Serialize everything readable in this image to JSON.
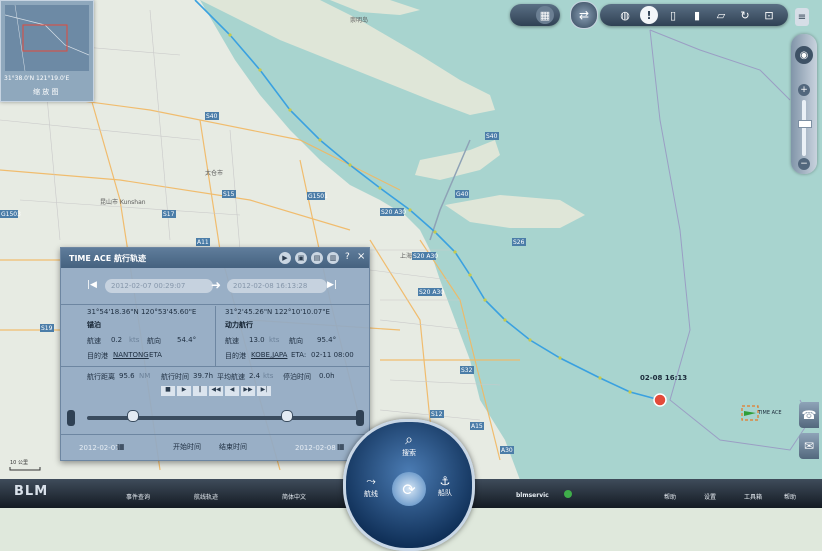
{
  "map": {
    "labels": [
      "S40",
      "S40",
      "G40",
      "G1501",
      "S20",
      "S20 A30",
      "S20 A30",
      "S20 A30",
      "S15",
      "S17",
      "S32",
      "S12",
      "S19",
      "A11",
      "S26",
      "A30",
      "A15",
      "S4",
      "G1503",
      "A20",
      "S5",
      "昆山市 Kunshan",
      "太仓市",
      "舟山群岛",
      "上海"
    ],
    "route_label": "02-08 16:13",
    "vessel_label": "TIME ACE"
  },
  "minimap": {
    "coord_text": "31°38.0'N 121°19.0'E",
    "label": "缩 放 图"
  },
  "toolbar": {
    "icons": [
      "globe-icon",
      "info-icon",
      "list-icon",
      "ruler-icon",
      "note-icon",
      "refresh-icon",
      "settings-icon"
    ]
  },
  "panel": {
    "title": "TIME ACE 航行轨迹",
    "start_time": "2012-02-07 00:29:07",
    "end_time": "2012-02-08 16:13:28",
    "left": {
      "coord": "31°54'18.36\"N 120°53'45.60\"E",
      "status": "锚泊",
      "speed_label": "航速",
      "speed": "0.2",
      "speed_unit": "kts",
      "course_label": "航向",
      "course": "54.4°",
      "dest_label": "目的港",
      "dest": "NANTONG",
      "eta_label": "ETA"
    },
    "right": {
      "coord": "31°2'45.26\"N 122°10'10.07\"E",
      "status": "动力航行",
      "speed_label": "航速",
      "speed": "13.0",
      "speed_unit": "kts",
      "course_label": "航向",
      "course": "95.4°",
      "dest_label": "目的港",
      "dest": "KOBE,JAPA",
      "eta_label": "ETA:",
      "eta": "02-11 08:00"
    },
    "stats": {
      "range_label": "航行距离",
      "range": "95.6",
      "range_unit": "NM",
      "time_label": "航行时间",
      "time": "39.7h",
      "avg_label": "平均航速",
      "avg": "2.4",
      "avg_unit": "kts",
      "stop_label": "停泊时间",
      "stop": "0.0h"
    },
    "footer": {
      "start_date": "2012-02-07",
      "start_btn": "开始时间",
      "end_btn": "结束时间",
      "end_date": "2012-02-08"
    }
  },
  "hub": {
    "top": "搜索",
    "left": "航线",
    "right": "船队"
  },
  "bottom": {
    "logo": "BLM",
    "items": [
      "事件查询",
      "航线轨迹",
      "简体中文"
    ],
    "user": "blmservic",
    "right_items": [
      "帮助",
      "设置",
      "工具箱",
      "帮助"
    ]
  },
  "scale": {
    "label": "10 公里"
  }
}
